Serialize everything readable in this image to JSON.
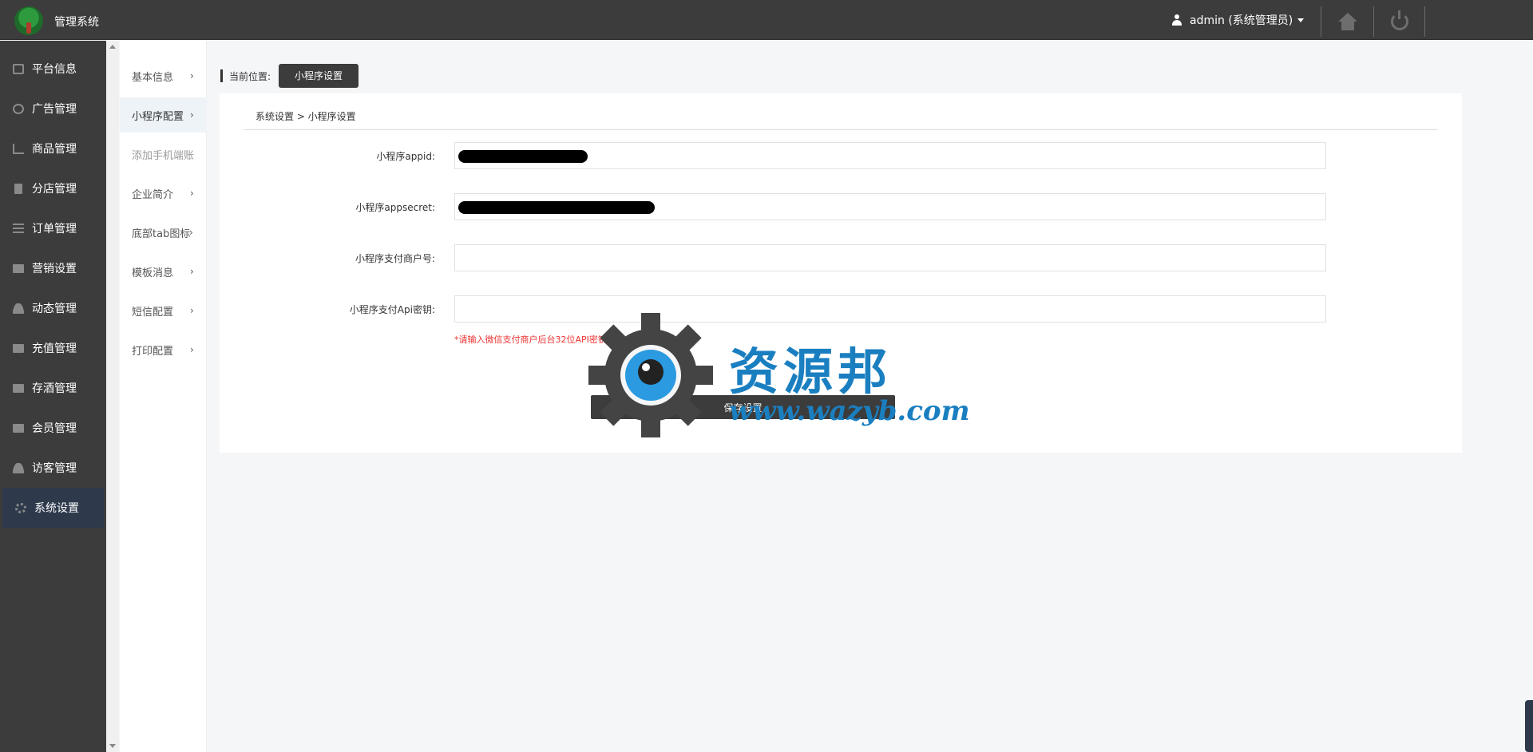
{
  "header": {
    "app_title": "管理系统",
    "user_label": "admin (系统管理员)"
  },
  "sidebar": {
    "items": [
      {
        "label": "平台信息",
        "icon": "newspaper-icon"
      },
      {
        "label": "广告管理",
        "icon": "globe-icon"
      },
      {
        "label": "商品管理",
        "icon": "cart-icon"
      },
      {
        "label": "分店管理",
        "icon": "building-icon"
      },
      {
        "label": "订单管理",
        "icon": "list-icon"
      },
      {
        "label": "营销设置",
        "icon": "gift-icon"
      },
      {
        "label": "动态管理",
        "icon": "user-icon"
      },
      {
        "label": "充值管理",
        "icon": "gift-icon"
      },
      {
        "label": "存酒管理",
        "icon": "gift-icon"
      },
      {
        "label": "会员管理",
        "icon": "gift-icon"
      },
      {
        "label": "访客管理",
        "icon": "user-icon"
      },
      {
        "label": "系统设置",
        "icon": "gear-icon",
        "active": true
      }
    ]
  },
  "subnav": {
    "items": [
      {
        "label": "基本信息",
        "chevron": "›"
      },
      {
        "label": "小程序配置",
        "chevron": "›",
        "active": true
      },
      {
        "label": "添加手机端账",
        "chevron": ""
      },
      {
        "label": "企业简介",
        "chevron": "›"
      },
      {
        "label": "底部tab图标",
        "chevron": "›"
      },
      {
        "label": "模板消息",
        "chevron": "›"
      },
      {
        "label": "短信配置",
        "chevron": "›"
      },
      {
        "label": "打印配置",
        "chevron": "›"
      }
    ]
  },
  "location": {
    "label": "当前位置:",
    "current": "小程序设置"
  },
  "panel": {
    "breadcrumb": "系统设置 > 小程序设置",
    "fields": [
      {
        "label": "小程序appid:",
        "value": ""
      },
      {
        "label": "小程序appsecret:",
        "value": ""
      },
      {
        "label": "小程序支付商户号:",
        "value": ""
      },
      {
        "label": "小程序支付Api密钥:",
        "value": ""
      }
    ],
    "hint": "*请输入微信支付商户后台32位API密钥",
    "save_label": "保存设置"
  },
  "watermark": {
    "chinese": "资源邦",
    "url": "www.wazyb.com"
  },
  "colors": {
    "header_bg": "#3c3c3c",
    "sidebar_active": "#2e3a4c",
    "hint_red": "#e33333",
    "watermark_blue": "#1a7fc0"
  }
}
